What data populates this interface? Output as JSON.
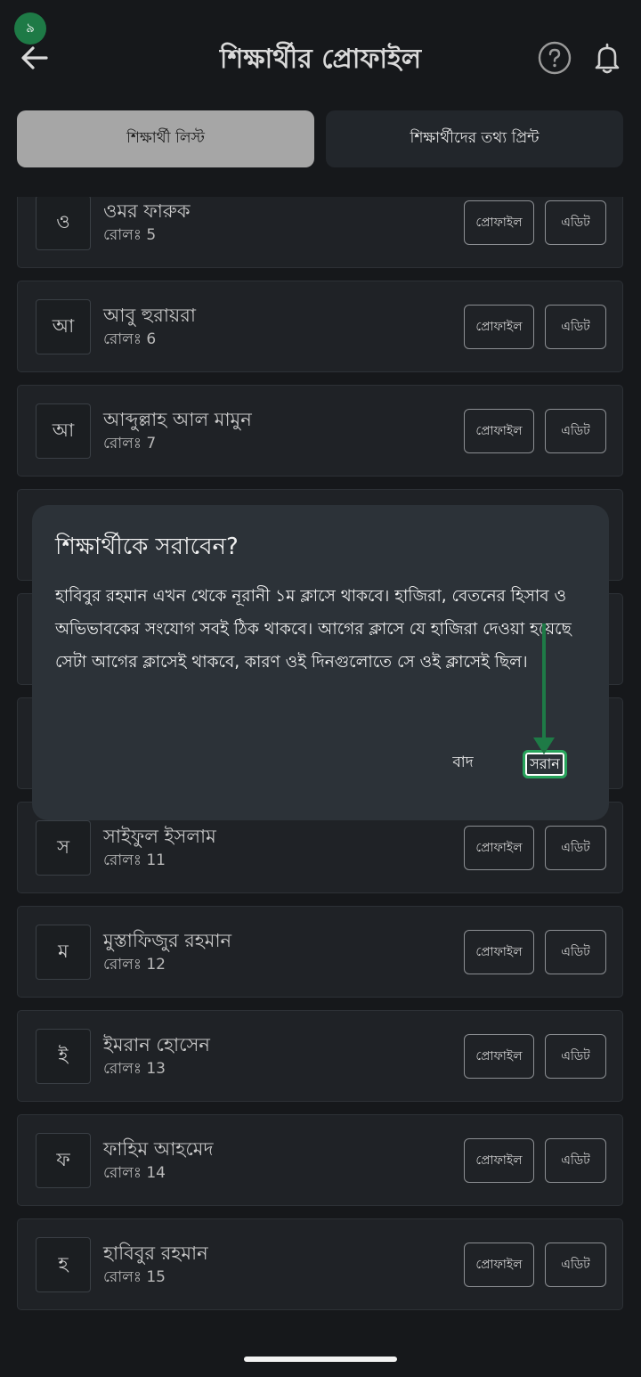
{
  "status": {
    "step_badge": "৯"
  },
  "header": {
    "title": "শিক্ষার্থীর প্রোফাইল"
  },
  "tabs": [
    {
      "label": "শিক্ষার্থী লিস্ট",
      "active": true
    },
    {
      "label": "শিক্ষার্থীদের তথ্য প্রিন্ট",
      "active": false
    }
  ],
  "student_buttons": {
    "profile": "প্রোফাইল",
    "edit": "এডিট"
  },
  "students": [
    {
      "initial": "ও",
      "name": "ওমর ফারুক",
      "roll": "রোলঃ 5"
    },
    {
      "initial": "আ",
      "name": "আবু হুরায়রা",
      "roll": "রোলঃ 6"
    },
    {
      "initial": "আ",
      "name": "আব্দুল্লাহ আল মামুন",
      "roll": "রোলঃ 7"
    },
    {
      "initial": "স",
      "name": "সাইফুল ইসলাম",
      "roll": "রোলঃ 11"
    },
    {
      "initial": "ম",
      "name": "মুস্তাফিজুর রহমান",
      "roll": "রোলঃ 12"
    },
    {
      "initial": "ই",
      "name": "ইমরান হোসেন",
      "roll": "রোলঃ 13"
    },
    {
      "initial": "ফ",
      "name": "ফাহিম আহমেদ",
      "roll": "রোলঃ 14"
    },
    {
      "initial": "হ",
      "name": "হাবিবুর রহমান",
      "roll": "রোলঃ 15"
    }
  ],
  "dialog": {
    "title": "শিক্ষার্থীকে সরাবেন?",
    "message": "হাবিবুর রহমান এখন থেকে নূরানী ১ম ক্লাসে থাকবে। হাজিরা, বেতনের হিসাব ও অভিভাবকের সংযোগ সবই ঠিক থাকবে। আগের ক্লাসে যে হাজিরা দেওয়া হয়েছে সেটা আগের ক্লাসেই থাকবে, কারণ ওই দিনগুলোতে সে ওই ক্লাসেই ছিল।",
    "cancel_label": "বাদ",
    "confirm_label": "সরান"
  },
  "colors": {
    "background": "#16181b",
    "card": "#1f2226",
    "dialog": "#2c3238",
    "accent": "#1e7a46",
    "highlight": "#27a35b"
  },
  "icons": [
    "back-arrow-icon",
    "help-icon",
    "bell-icon",
    "pointer-arrow-icon"
  ]
}
